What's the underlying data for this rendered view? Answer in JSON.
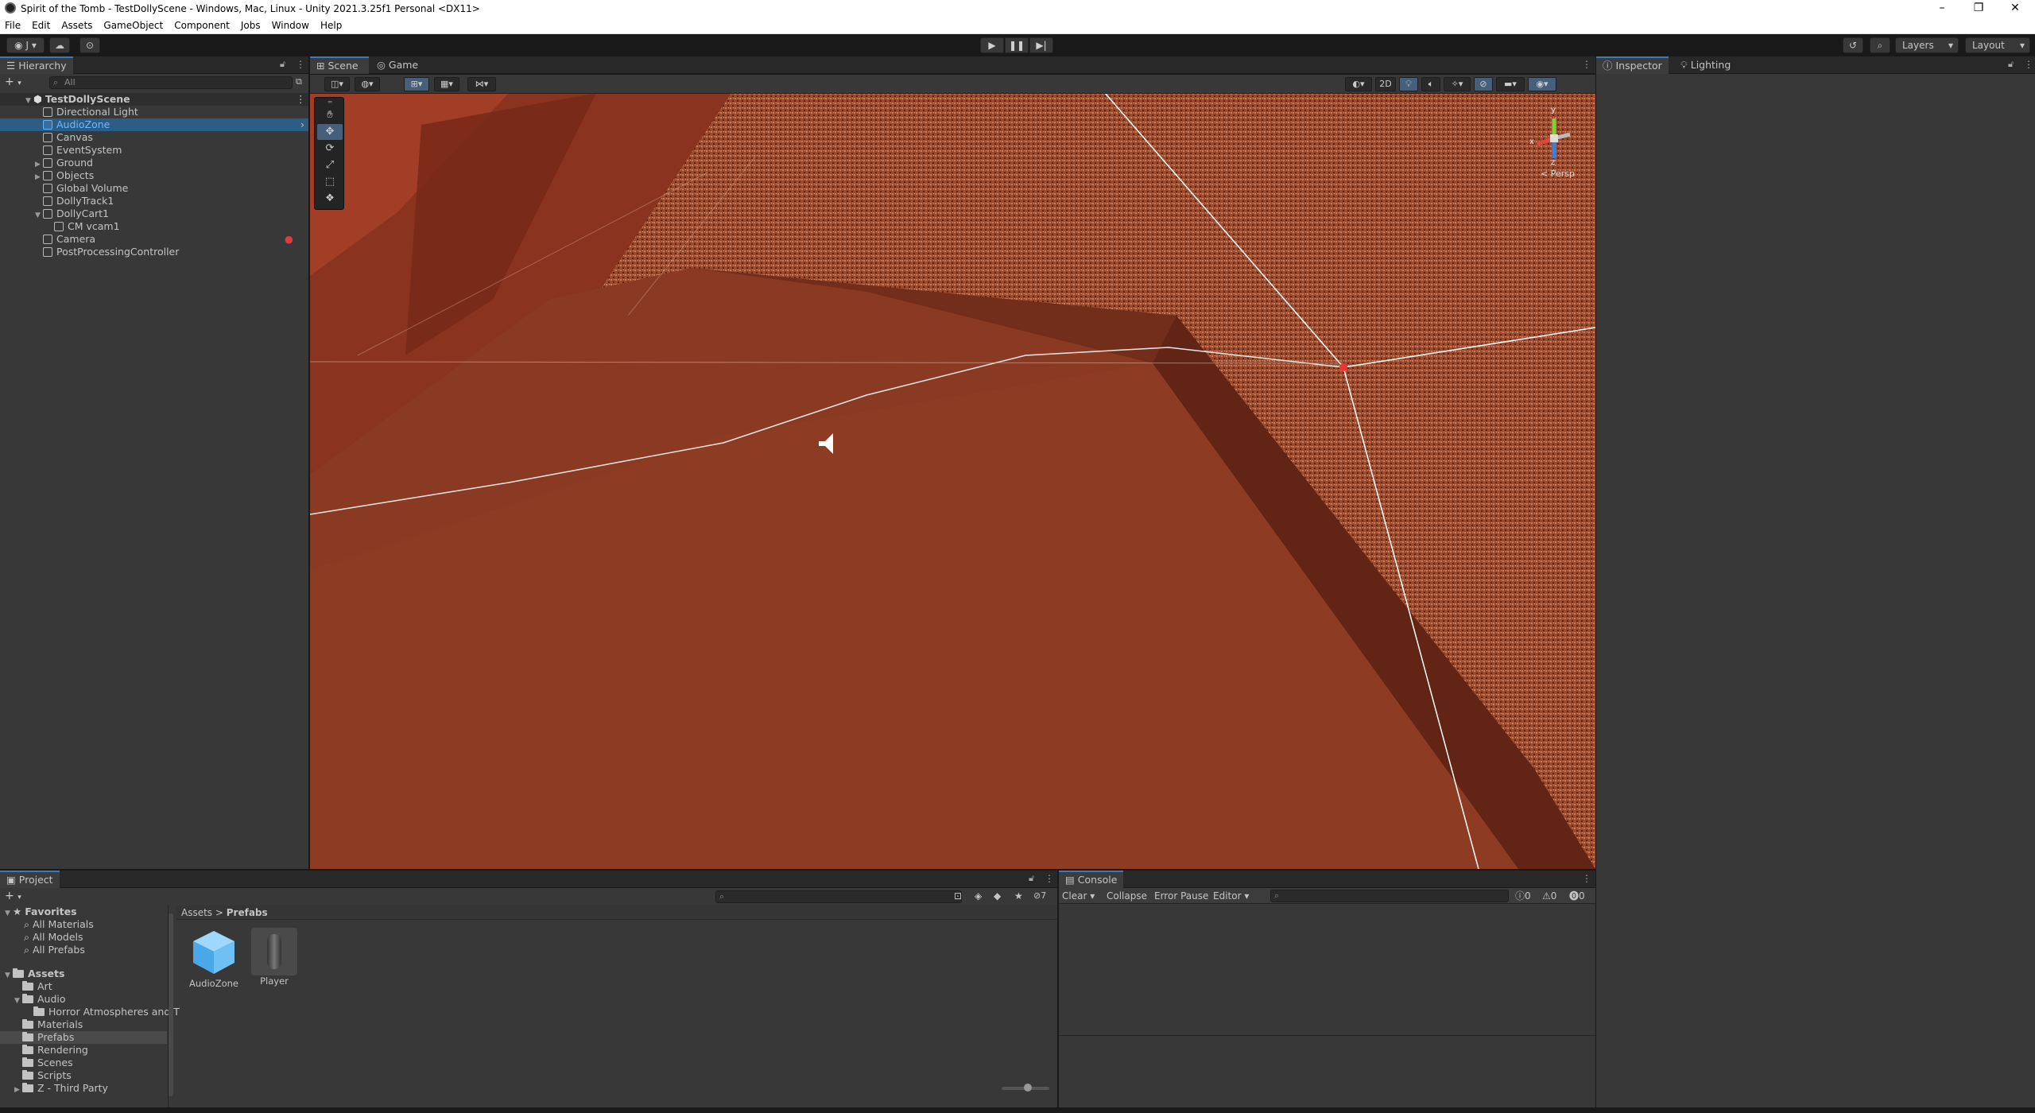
{
  "window": {
    "title": "Spirit of the Tomb - TestDollyScene - Windows, Mac, Linux - Unity 2021.3.25f1 Personal <DX11>",
    "minimize": "–",
    "restore": "❐",
    "close": "✕"
  },
  "menu": [
    "File",
    "Edit",
    "Assets",
    "GameObject",
    "Component",
    "Jobs",
    "Window",
    "Help"
  ],
  "toolbar": {
    "account": "J",
    "layers": "Layers",
    "layout": "Layout"
  },
  "scene_tabs": [
    {
      "label": "Scene",
      "icon": "grid-icon"
    },
    {
      "label": "Game",
      "icon": "gamepad-icon"
    }
  ],
  "scene": {
    "mode_2d": "2D",
    "gizmo_label": "< Persp",
    "axis_x": "x",
    "axis_y": "y",
    "axis_z": "z"
  },
  "hierarchy": {
    "title": "Hierarchy",
    "search_placeholder": "All",
    "scene_name": "TestDollyScene",
    "items": [
      {
        "label": "Directional Light",
        "depth": 1,
        "expandable": false
      },
      {
        "label": "AudioZone",
        "depth": 1,
        "expandable": false,
        "selected": true,
        "prefab": true
      },
      {
        "label": "Canvas",
        "depth": 1,
        "expandable": false
      },
      {
        "label": "EventSystem",
        "depth": 1,
        "expandable": false
      },
      {
        "label": "Ground",
        "depth": 1,
        "expandable": true
      },
      {
        "label": "Objects",
        "depth": 1,
        "expandable": true
      },
      {
        "label": "Global Volume",
        "depth": 1,
        "expandable": false
      },
      {
        "label": "DollyTrack1",
        "depth": 1,
        "expandable": false
      },
      {
        "label": "DollyCart1",
        "depth": 1,
        "expandable": true,
        "expanded": true
      },
      {
        "label": "CM vcam1",
        "depth": 2,
        "expandable": false
      },
      {
        "label": "Camera",
        "depth": 1,
        "expandable": false,
        "warning": true
      },
      {
        "label": "PostProcessingController",
        "depth": 1,
        "expandable": false
      }
    ]
  },
  "inspector_tabs": [
    "Inspector",
    "Lighting"
  ],
  "project": {
    "title": "Project",
    "favorites_label": "Favorites",
    "favorites": [
      "All Materials",
      "All Models",
      "All Prefabs"
    ],
    "assets_label": "Assets",
    "folders": [
      {
        "label": "Art",
        "depth": 1
      },
      {
        "label": "Audio",
        "depth": 1,
        "expanded": true
      },
      {
        "label": "Horror Atmospheres and T",
        "depth": 2
      },
      {
        "label": "Materials",
        "depth": 1
      },
      {
        "label": "Prefabs",
        "depth": 1,
        "selected": true
      },
      {
        "label": "Rendering",
        "depth": 1
      },
      {
        "label": "Scenes",
        "depth": 1
      },
      {
        "label": "Scripts",
        "depth": 1
      },
      {
        "label": "Z - Third Party",
        "depth": 1,
        "expandable": true
      }
    ],
    "breadcrumb": [
      "Assets",
      "Prefabs"
    ],
    "assets": [
      {
        "label": "AudioZone",
        "kind": "cube"
      },
      {
        "label": "Player",
        "kind": "capsule"
      }
    ],
    "hidden_count": "7"
  },
  "console": {
    "title": "Console",
    "clear": "Clear",
    "collapse": "Collapse",
    "error_pause": "Error Pause",
    "editor": "Editor",
    "log_count": "0",
    "warn_count": "0",
    "error_count": "0"
  },
  "colors": {
    "accent": "#3a79bb",
    "selection": "#2c5d87",
    "panel": "#383838",
    "scene_ground": "#8a3a22"
  }
}
